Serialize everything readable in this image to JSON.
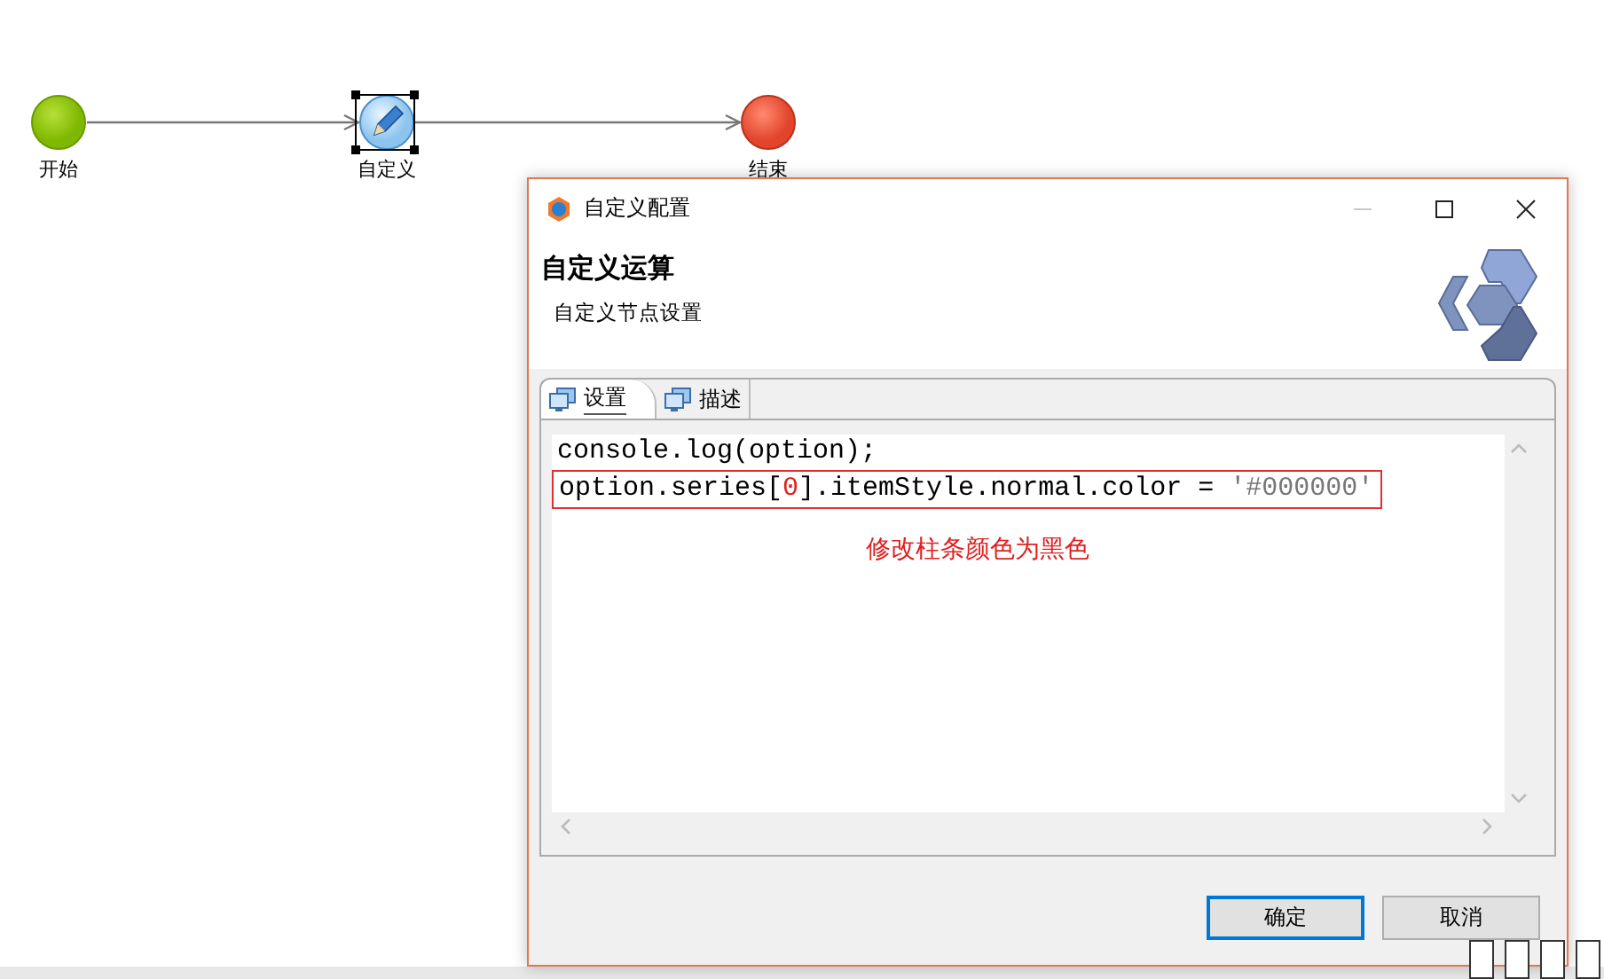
{
  "diagram": {
    "nodes": [
      {
        "label": "开始",
        "kind": "start",
        "selected": false
      },
      {
        "label": "自定义",
        "kind": "task",
        "selected": true
      },
      {
        "label": "结束",
        "kind": "end",
        "selected": false
      }
    ]
  },
  "dialog": {
    "title": "自定义配置",
    "minimize_disabled": true,
    "heading": "自定义运算",
    "subheading": "自定义节点设置",
    "tabs": [
      {
        "label": "设置",
        "selected": true
      },
      {
        "label": "描述",
        "selected": false
      }
    ],
    "code_lines": [
      {
        "highlighted": false,
        "segments": [
          {
            "text": "console.log(option);",
            "kind": "plain"
          }
        ]
      },
      {
        "highlighted": true,
        "segments": [
          {
            "text": "option.series[",
            "kind": "plain"
          },
          {
            "text": "0",
            "kind": "number"
          },
          {
            "text": "].itemStyle.normal.color = ",
            "kind": "plain"
          },
          {
            "text": "'#000000'",
            "kind": "string"
          }
        ]
      }
    ],
    "annotation": "修改柱条颜色为黑色",
    "buttons": [
      {
        "label": "确定",
        "default": true
      },
      {
        "label": "取消",
        "default": false
      }
    ]
  }
}
